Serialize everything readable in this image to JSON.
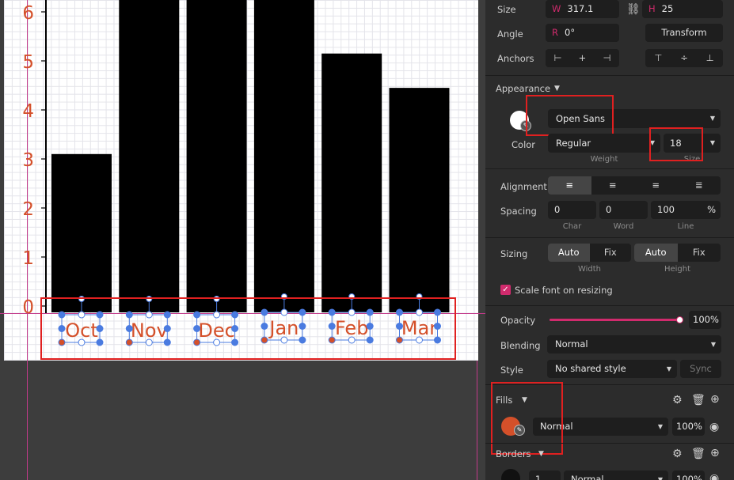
{
  "chart_data": {
    "type": "bar",
    "categories": [
      "Oct",
      "Nov",
      "Dec",
      "Jan",
      "Feb",
      "Mar"
    ],
    "values": [
      3.1,
      6.5,
      6.5,
      6.5,
      5.15,
      4.45
    ],
    "ylim": [
      0,
      6.3
    ],
    "y_ticks": [
      "0",
      "1",
      "2",
      "3",
      "4",
      "5",
      "6"
    ],
    "grid": true,
    "bar_color": "#000000",
    "label_color": "#d4502a"
  },
  "panel": {
    "size_label": "Size",
    "width_prefix": "W",
    "width_value": "317.1",
    "height_prefix": "H",
    "height_value": "25",
    "angle_label": "Angle",
    "rotation_prefix": "R",
    "rotation_value": "0°",
    "transform_label": "Transform",
    "anchors_label": "Anchors",
    "appearance_label": "Appearance",
    "font_family": "Open Sans",
    "color_label": "Color",
    "weight_value": "Regular",
    "weight_label": "Weight",
    "font_size_value": "18",
    "font_size_label": "Size",
    "alignment_label": "Alignment",
    "spacing_label": "Spacing",
    "char_value": "0",
    "char_label": "Char",
    "word_value": "0",
    "word_label": "Word",
    "line_value": "100",
    "line_unit": "%",
    "line_label": "Line",
    "sizing_label": "Sizing",
    "width_auto": "Auto",
    "width_fix": "Fix",
    "width_label": "Width",
    "height_auto": "Auto",
    "height_fix": "Fix",
    "height_label": "Height",
    "scale_font_label": "Scale font on resizing",
    "opacity_label": "Opacity",
    "opacity_value": "100%",
    "opacity_fraction": 1.0,
    "blending_label": "Blending",
    "blending_value": "Normal",
    "style_label": "Style",
    "style_value": "No shared style",
    "sync_label": "Sync",
    "fills_label": "Fills",
    "fill_blend_value": "Normal",
    "fill_opacity_value": "100%",
    "fill_color": "#d4502a",
    "borders_label": "Borders",
    "border_thickness": "1",
    "border_blend_value": "Normal",
    "border_opacity_value": "100%"
  },
  "colors": {
    "accent": "#d12b6d",
    "annotation": "#e02020"
  }
}
